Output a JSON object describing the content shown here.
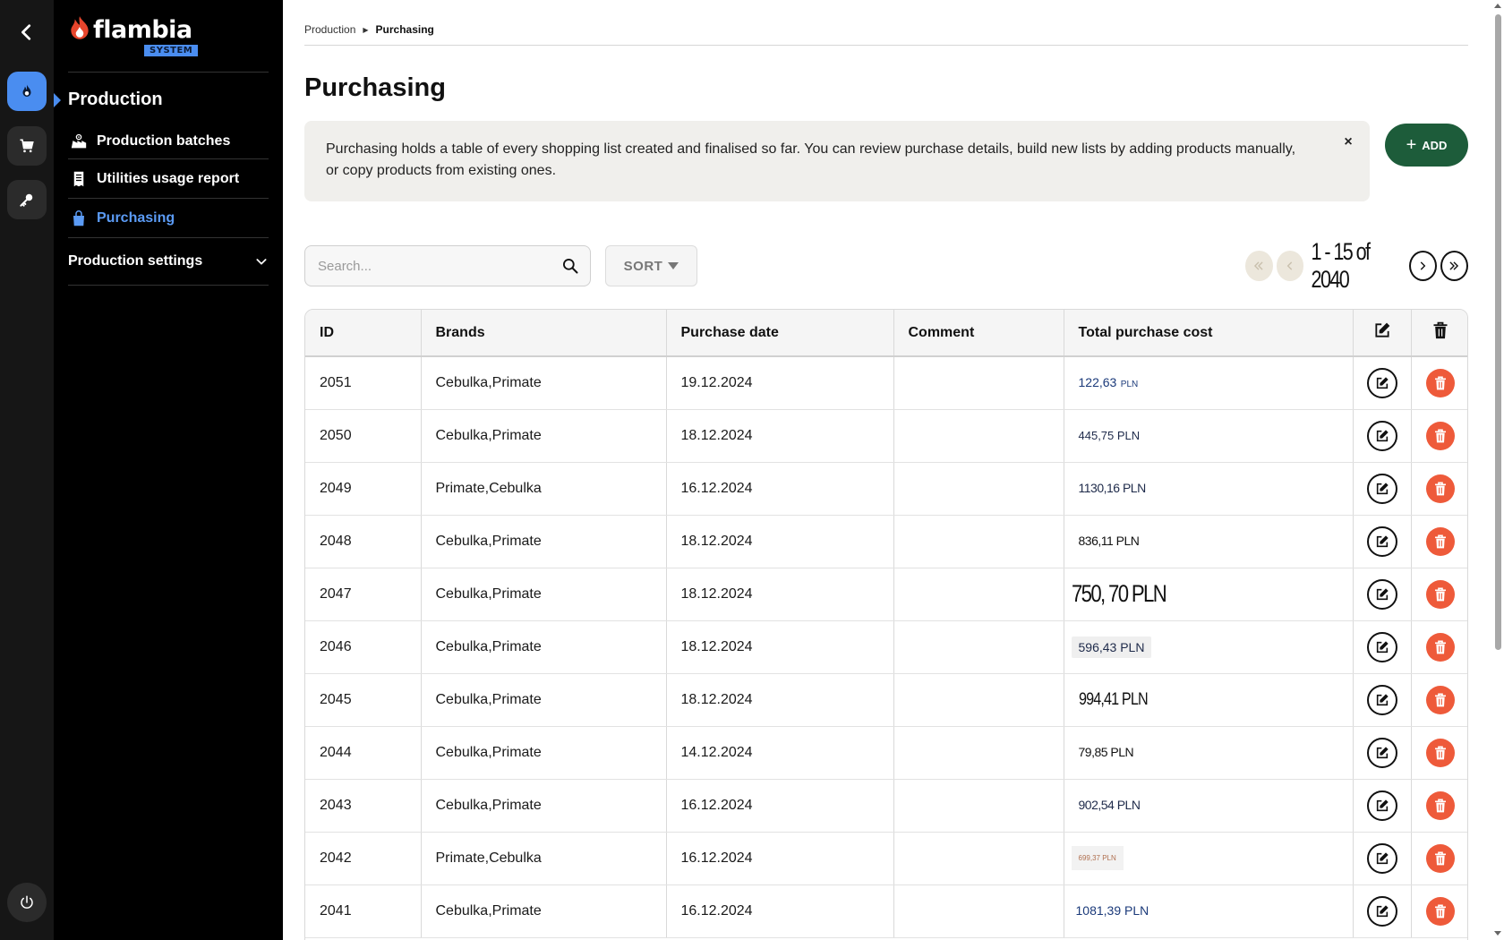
{
  "brand": {
    "name": "flambia",
    "badge": "SYSTEM"
  },
  "sidebar": {
    "section_title": "Production",
    "items": [
      {
        "label": "Production batches",
        "icon": "factory-icon",
        "active": false
      },
      {
        "label": "Utilities usage report",
        "icon": "receipt-icon",
        "active": false
      },
      {
        "label": "Purchasing",
        "icon": "shopping-bag-icon",
        "active": true
      }
    ],
    "settings_label": "Production settings"
  },
  "rail": {
    "items": [
      "flame-icon",
      "cart-icon",
      "key-icon"
    ],
    "active": "flame-icon"
  },
  "breadcrumb": {
    "parent": "Production",
    "current": "Purchasing"
  },
  "page": {
    "title": "Purchasing",
    "info_text": "Purchasing holds a table of every shopping list created and finalised so far. You can review purchase details, build new lists by adding products manually, or copy products from existing ones.",
    "close_label": "×",
    "add_label": "ADD"
  },
  "search": {
    "placeholder": "Search...",
    "value": ""
  },
  "sort": {
    "label": "SORT"
  },
  "pagination": {
    "text": "1 - 15 of 2040"
  },
  "table": {
    "columns": [
      "ID",
      "Brands",
      "Purchase date",
      "Comment",
      "Total purchase cost"
    ],
    "rows": [
      {
        "id": "2051",
        "brands": "Cebulka,Primate",
        "date": "19.12.2024",
        "comment": "",
        "cost": "122,63",
        "unit": "PLN"
      },
      {
        "id": "2050",
        "brands": "Cebulka,Primate",
        "date": "18.12.2024",
        "comment": "",
        "cost": "445,75 PLN",
        "unit": ""
      },
      {
        "id": "2049",
        "brands": "Primate,Cebulka",
        "date": "16.12.2024",
        "comment": "",
        "cost": "1130,16 PLN",
        "unit": ""
      },
      {
        "id": "2048",
        "brands": "Cebulka,Primate",
        "date": "18.12.2024",
        "comment": "",
        "cost": "836,11 PLN",
        "unit": ""
      },
      {
        "id": "2047",
        "brands": "Cebulka,Primate",
        "date": "18.12.2024",
        "comment": "",
        "cost": "750, 70 PLN",
        "unit": ""
      },
      {
        "id": "2046",
        "brands": "Cebulka,Primate",
        "date": "18.12.2024",
        "comment": "",
        "cost": "596,43 PLN",
        "unit": ""
      },
      {
        "id": "2045",
        "brands": "Cebulka,Primate",
        "date": "18.12.2024",
        "comment": "",
        "cost": "994,41 PLN",
        "unit": ""
      },
      {
        "id": "2044",
        "brands": "Cebulka,Primate",
        "date": "14.12.2024",
        "comment": "",
        "cost": "79,85 PLN",
        "unit": ""
      },
      {
        "id": "2043",
        "brands": "Cebulka,Primate",
        "date": "16.12.2024",
        "comment": "",
        "cost": "902,54 PLN",
        "unit": ""
      },
      {
        "id": "2042",
        "brands": "Primate,Cebulka",
        "date": "16.12.2024",
        "comment": "",
        "cost": "699,37 PLN",
        "unit": ""
      },
      {
        "id": "2041",
        "brands": "Cebulka,Primate",
        "date": "16.12.2024",
        "comment": "",
        "cost": "1081,39 PLN",
        "unit": ""
      }
    ]
  },
  "colors": {
    "accent_blue": "#4a8df0",
    "add_green": "#1d5c3a",
    "delete_red": "#ee5a3a",
    "sidebar_bg": "#000000"
  }
}
